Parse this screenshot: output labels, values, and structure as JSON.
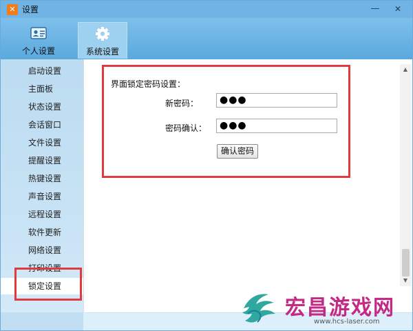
{
  "window": {
    "title": "设置",
    "app_icon": "app-logo-icon",
    "controls": {
      "minimize": "—",
      "close": "✕"
    }
  },
  "toolbar": {
    "tabs": [
      {
        "label": "个人设置",
        "icon": "id-card-icon",
        "selected": false
      },
      {
        "label": "系统设置",
        "icon": "gear-icon",
        "selected": true
      }
    ]
  },
  "sidebar": {
    "items": [
      {
        "label": "启动设置"
      },
      {
        "label": "主面板"
      },
      {
        "label": "状态设置"
      },
      {
        "label": "会话窗口"
      },
      {
        "label": "文件设置"
      },
      {
        "label": "提醒设置"
      },
      {
        "label": "热键设置"
      },
      {
        "label": "声音设置"
      },
      {
        "label": "远程设置"
      },
      {
        "label": "软件更新"
      },
      {
        "label": "网络设置"
      },
      {
        "label": "打印设置"
      },
      {
        "label": "锁定设置"
      }
    ],
    "active_item": "锁定设置"
  },
  "lock": {
    "section_title": "界面锁定密码设置：",
    "new_password_label": "新密码：",
    "new_password_value": "●●●",
    "confirm_password_label": "密码确认：",
    "confirm_password_value": "●●●",
    "confirm_button": "确认密码"
  },
  "colors": {
    "accent": "#6fb4e4",
    "highlight_box": "#e0393e",
    "watermark": "#c22a86"
  },
  "watermark": {
    "text": "宏昌游戏网",
    "url": "www.hcs-laser.com"
  }
}
